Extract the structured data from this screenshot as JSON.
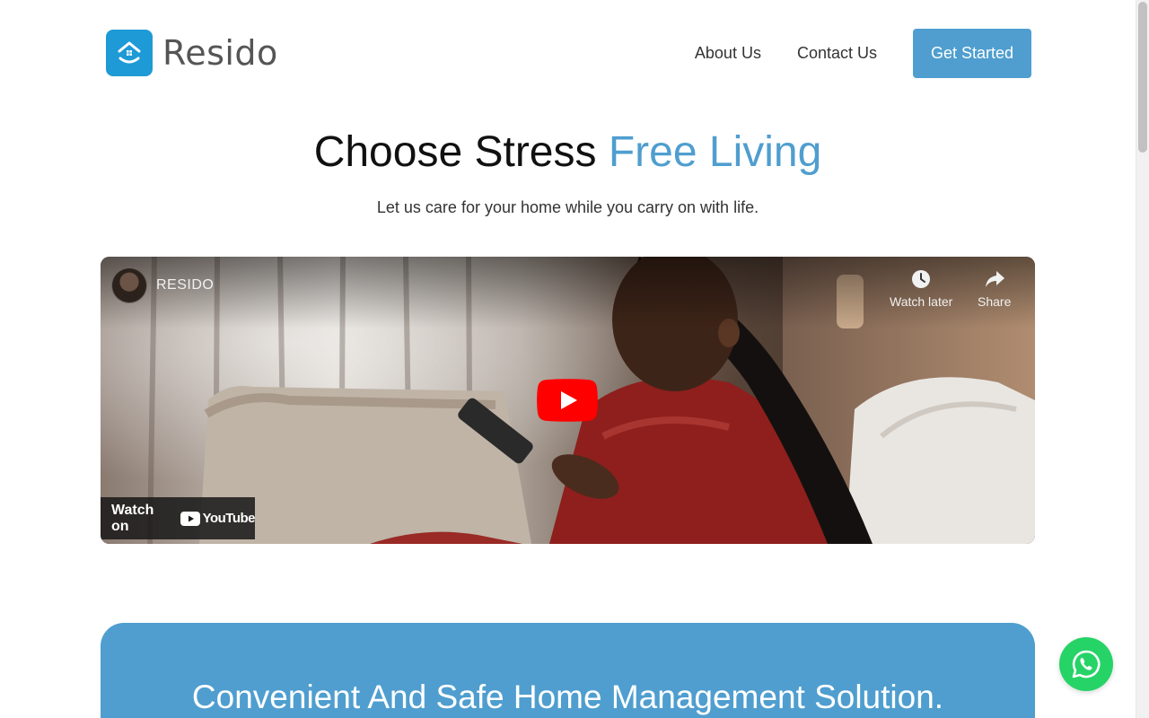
{
  "brand": {
    "name": "Resido",
    "logo_icon": "house-smile-icon",
    "logo_color": "#1e9ad6"
  },
  "nav": {
    "links": [
      {
        "label": "About Us"
      },
      {
        "label": "Contact Us"
      }
    ],
    "cta_label": "Get Started",
    "accent_color": "#4f9ecf"
  },
  "hero": {
    "title_main": "Choose Stress ",
    "title_accent": "Free Living",
    "subtitle": "Let us care for your home while you carry on with life."
  },
  "video": {
    "channel_name": "RESIDO",
    "watch_later_label": "Watch later",
    "share_label": "Share",
    "watch_on_label": "Watch on",
    "youtube_label": "YouTube"
  },
  "solution": {
    "title": "Convenient And Safe Home Management Solution.",
    "background_color": "#4f9ecf"
  },
  "whatsapp": {
    "icon": "whatsapp-icon",
    "color": "#25d366"
  }
}
